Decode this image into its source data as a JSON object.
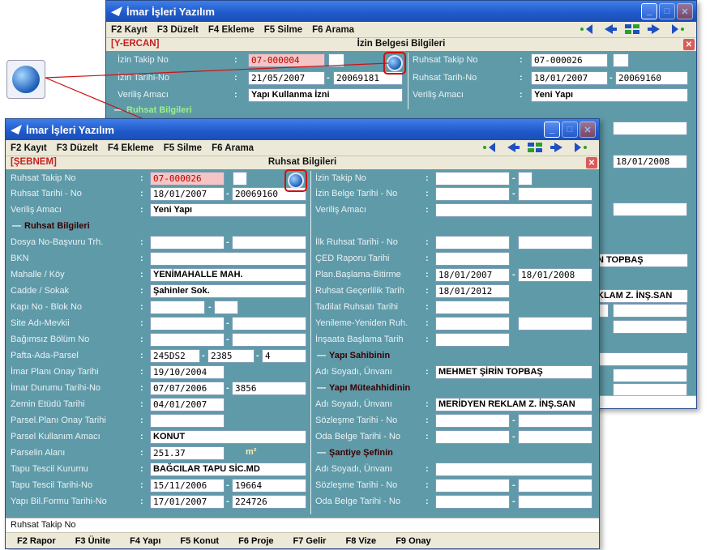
{
  "window_back": {
    "title": "İmar İşleri Yazılım",
    "menu": [
      "F2 Kayıt",
      "F3 Düzelt",
      "F4 Ekleme",
      "F5 Silme",
      "F6 Arama"
    ],
    "user": "[Y-ERCAN]",
    "panel_title": "İzin Belgesi Bilgileri",
    "left_labels": [
      "İzin Takip No",
      "İzin Tarihi-No",
      "Veriliş Amacı"
    ],
    "izin_takip_no": "07-000004",
    "izin_tarihi": "21/05/2007",
    "izin_no": "20069181",
    "verilis_amaci": "Yapı Kullanma İzni",
    "section": "Ruhsat Bilgileri",
    "right_labels": [
      "Ruhsat Takip No",
      "Ruhsat Tarih-No",
      "Veriliş Amacı"
    ],
    "ruhsat_takip_no": "07-000026",
    "ruhsat_tarih": "18/01/2007",
    "ruhsat_no": "20069160",
    "ruhsat_verilis": "Yeni Yapı",
    "peek_date": "18/01/2008",
    "peek_name": "N TOPBAŞ",
    "peek_company": "KLAM Z. İNŞ.SAN"
  },
  "window_front": {
    "title": "İmar İşleri Yazılım",
    "menu": [
      "F2 Kayıt",
      "F3 Düzelt",
      "F4 Ekleme",
      "F5 Silme",
      "F6 Arama"
    ],
    "user": "[ŞEBNEM]",
    "panel_title": "Ruhsat Bilgileri",
    "left": {
      "ruhsat_takip_no_label": "Ruhsat Takip No",
      "ruhsat_takip_no": "07-000026",
      "ruhsat_tarihi_label": "Ruhsat Tarihi - No",
      "ruhsat_tarihi": "18/01/2007",
      "ruhsat_no": "20069160",
      "verilis_label": "Veriliş Amacı",
      "verilis": "Yeni Yapı",
      "section_ruhsat": "Ruhsat Bilgileri",
      "dosya_label": "Dosya No-Başvuru Trh.",
      "bkn_label": "BKN",
      "mahalle_label": "Mahalle / Köy",
      "mahalle": "YENİMAHALLE MAH.",
      "cadde_label": "Cadde / Sokak",
      "cadde": "Şahinler Sok.",
      "kapi_label": "Kapı No - Blok No",
      "site_label": "Site Adı-Mevkii",
      "bagimsiz_label": "Bağımsız Bölüm No",
      "pafta_label": "Pafta-Ada-Parsel",
      "pafta": "245DS2",
      "ada": "2385",
      "parsel": "4",
      "imar_plan_label": "İmar Planı Onay Tarihi",
      "imar_plan": "19/10/2004",
      "imar_durum_label": "İmar Durumu Tarihi-No",
      "imar_durum": "07/07/2006",
      "imar_durum_no": "3856",
      "zemin_label": "Zemin Etüdü Tarihi",
      "zemin": "04/01/2007",
      "parsel_plan_label": "Parsel.Planı Onay Tarihi",
      "parsel_kullanim_label": "Parsel Kullanım Amacı",
      "parsel_kullanim": "KONUT",
      "parsel_alani_label": "Parselin Alanı",
      "parsel_alani": "251.37",
      "m2": "m²",
      "tapu_kurum_label": "Tapu Tescil Kurumu",
      "tapu_kurum": "BAĞCILAR TAPU SİC.MD",
      "tapu_tarih_label": "Tapu Tescil Tarihi-No",
      "tapu_tarih": "15/11/2006",
      "tapu_no": "19664",
      "yapi_bil_label": "Yapı Bil.Formu Tarihi-No",
      "yapi_bil": "17/01/2007",
      "yapi_bil_no": "224726"
    },
    "right": {
      "izin_takip_label": "İzin Takip No",
      "izin_belge_label": "İzin Belge Tarihi - No",
      "verilis_label": "Veriliş Amacı",
      "ilk_ruhsat_label": "İlk Ruhsat Tarihi - No",
      "ced_label": "ÇED Raporu Tarihi",
      "plan_label": "Plan.Başlama-Bitirme",
      "plan_bas": "18/01/2007",
      "plan_bit": "18/01/2008",
      "gecerlilik_label": "Ruhsat Geçerlilik Tarih",
      "gecerlilik": "18/01/2012",
      "tadilat_label": "Tadilat Ruhsatı Tarihi",
      "yenileme_label": "Yenileme-Yeniden Ruh.",
      "insaat_label": "İnşaata Başlama Tarih",
      "sec_sahip": "Yapı Sahibinin",
      "sahip_ad_label": "Adı Soyadı, Ünvanı",
      "sahip_ad": "MEHMET ŞİRİN TOPBAŞ",
      "sec_muteahhit": "Yapı Müteahhidinin",
      "muteahhit_ad_label": "Adı Soyadı, Ünvanı",
      "muteahhit_ad": "MERİDYEN REKLAM Z. İNŞ.SAN",
      "sozlesme_label": "Sözleşme Tarihi - No",
      "oda_label": "Oda Belge Tarihi - No",
      "sec_santiye": "Şantiye Şefinin",
      "santiye_ad_label": "Adı Soyadı, Ünvanı",
      "santiye_sozlesme_label": "Sözleşme Tarihi - No",
      "santiye_oda_label": "Oda Belge Tarihi - No"
    },
    "status": "Ruhsat Takip No",
    "fkeys": [
      "F2 Rapor",
      "F3 Ünite",
      "F4 Yapı",
      "F5 Konut",
      "F6 Proje",
      "F7 Gelir",
      "F8 Vize",
      "F9 Onay"
    ]
  }
}
